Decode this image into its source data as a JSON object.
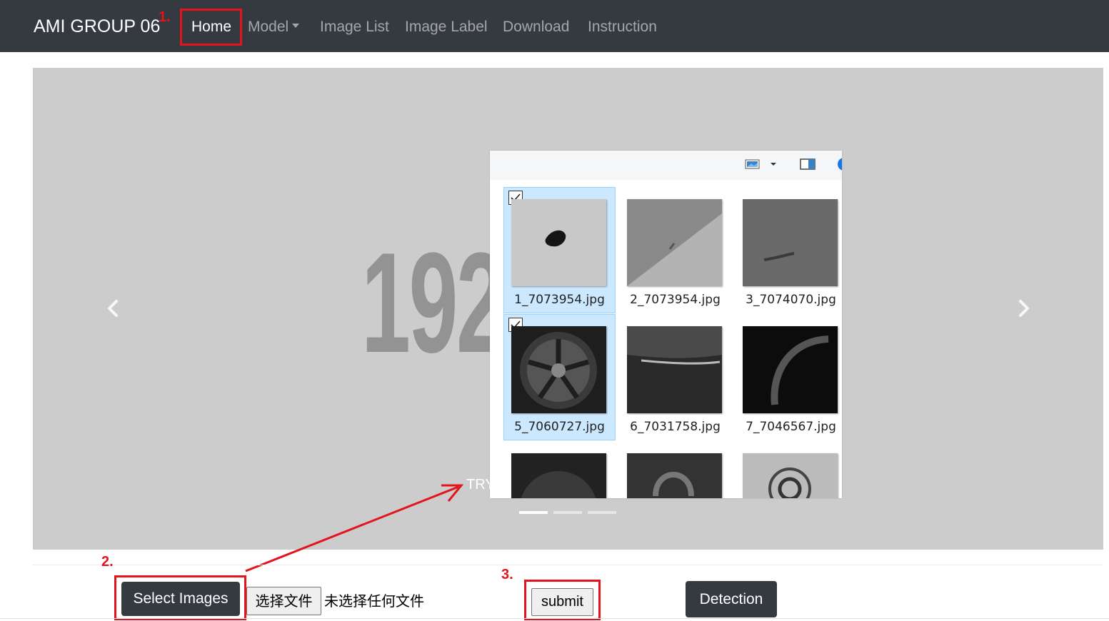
{
  "navbar": {
    "brand": "AMI GROUP 06",
    "links": {
      "home": "Home",
      "model": "Model",
      "image_list": "Image List",
      "image_label": "Image Label",
      "download": "Download",
      "instruction": "Instruction"
    }
  },
  "carousel": {
    "slide_text": "192",
    "caption": "TRY",
    "indicator_count": 3,
    "active_indicator": 1
  },
  "file_picker": {
    "files": [
      {
        "name": "1_7073954.jpg",
        "selected": true
      },
      {
        "name": "2_7073954.jpg",
        "selected": false
      },
      {
        "name": "3_7074070.jpg",
        "selected": false
      },
      {
        "name": "5_7060727.jpg",
        "selected": true
      },
      {
        "name": "6_7031758.jpg",
        "selected": false
      },
      {
        "name": "7_7046567.jpg",
        "selected": false
      }
    ]
  },
  "actions": {
    "select_images": "Select Images",
    "choose_file": "选择文件",
    "no_file": "未选择任何文件",
    "submit": "submit",
    "detection": "Detection"
  },
  "annotations": {
    "step1": "1.",
    "step2": "2.",
    "step3": "3.",
    "color": "#e3141c"
  }
}
